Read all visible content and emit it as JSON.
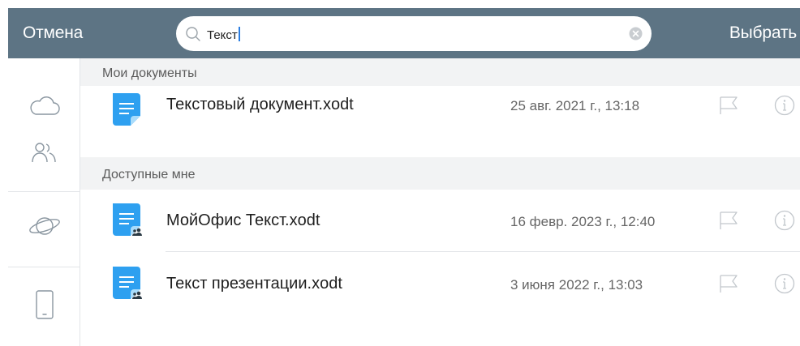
{
  "toolbar": {
    "cancel_label": "Отмена",
    "select_label": "Выбрать",
    "search_value": "Текст"
  },
  "sections": [
    {
      "title": "Мои документы",
      "items": [
        {
          "name": "Текстовый документ.xodt",
          "date": "25 авг. 2021 г., 13:18",
          "shared": false
        }
      ]
    },
    {
      "title": "Доступные мне",
      "items": [
        {
          "name": "МойОфис Текст.xodt",
          "date": "16 февр. 2023 г., 12:40",
          "shared": true
        },
        {
          "name": "Текст презентации.xodt",
          "date": "3 июня 2022 г., 13:03",
          "shared": true
        }
      ]
    }
  ],
  "sidebar": {
    "icons": [
      "cloud-icon",
      "shared-users-icon",
      "planet-icon",
      "device-icon"
    ]
  },
  "colors": {
    "toolbar_bg": "#5d7484",
    "doc_icon_blue": "#2ea0f0",
    "list_bg": "#f2f3f4"
  }
}
